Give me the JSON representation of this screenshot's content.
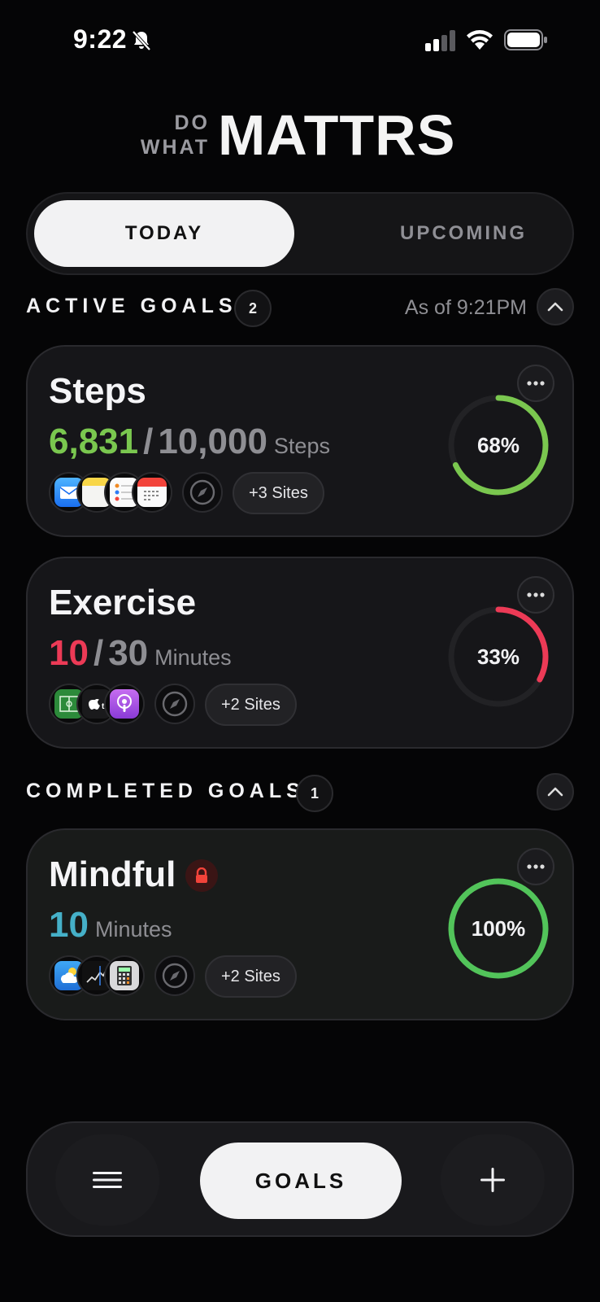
{
  "status_bar": {
    "time": "9:22"
  },
  "logo": {
    "line1": "DO",
    "line2": "WHAT",
    "brand": "MATTRS"
  },
  "tabs": {
    "today": "TODAY",
    "upcoming": "UPCOMING"
  },
  "active_section": {
    "title": "ACTIVE GOALS",
    "count": "2",
    "as_of": "As of 9:21PM"
  },
  "completed_section": {
    "title": "COMPLETED GOALS",
    "count": "1"
  },
  "goals": [
    {
      "title": "Steps",
      "current": "6,831",
      "separator": "/",
      "target": "10,000",
      "unit": "Steps",
      "percent_label": "68%",
      "progress": 0.68,
      "color": "#7ac74f",
      "sites": "+3 Sites",
      "apps": [
        "mail-icon",
        "notes-icon",
        "reminders-icon",
        "calendar-icon"
      ]
    },
    {
      "title": "Exercise",
      "current": "10",
      "separator": "/",
      "target": "30",
      "unit": "Minutes",
      "percent_label": "33%",
      "progress": 0.33,
      "color": "#ec3a56",
      "sites": "+2 Sites",
      "apps": [
        "numbers-icon",
        "apple-tv-icon",
        "podcasts-icon"
      ]
    },
    {
      "title": "Mindful",
      "current": "10",
      "unit": "Minutes",
      "percent_label": "100%",
      "progress": 1.0,
      "color": "#52c45a",
      "value_color": "#45b0c8",
      "sites": "+2 Sites",
      "locked": true,
      "apps": [
        "weather-icon",
        "stocks-icon",
        "calculator-icon"
      ]
    }
  ],
  "bottom_bar": {
    "goals_label": "GOALS"
  }
}
